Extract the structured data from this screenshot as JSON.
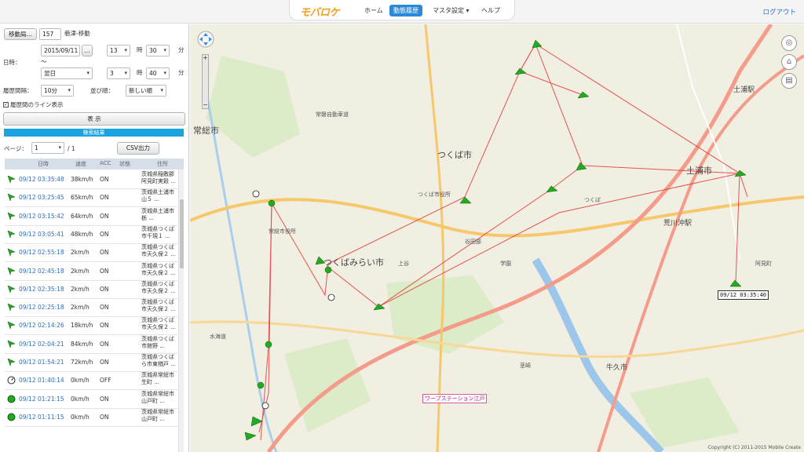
{
  "header": {
    "logo": "モバロケ",
    "nav": [
      "ホーム",
      "動態履歴",
      "マスタ設定 ▾",
      "ヘルプ"
    ],
    "active_index": 1,
    "logout": "ログアウト"
  },
  "search": {
    "device_button": "移動局...",
    "device_id": "157",
    "device_name": "砦津-移動",
    "datetime_label": "日時：",
    "start_date": "2015/09/11",
    "start_hour": "13",
    "hour_unit": "時",
    "start_min": "30",
    "min_unit": "分",
    "tilde": "～",
    "end_date": "翌日",
    "end_hour": "3",
    "end_min": "40",
    "interval_label": "履歴間隔：",
    "interval": "10分",
    "order_label": "並び順：",
    "order": "新しい順",
    "line_label": "履歴間のライン表示",
    "show_button": "表 示",
    "result_label": "検索結果",
    "page_label": "ページ：",
    "page": "1",
    "page_total": "/ 1",
    "csv_button": "CSV出力"
  },
  "table": {
    "headers": [
      "日時",
      "速度",
      "ACC",
      "状態",
      "住所"
    ],
    "rows": [
      {
        "dt": "09/12 03:35:48",
        "sp": "38km/h",
        "acc": "ON",
        "addr": "茨城県稲敷郡阿見町実穀 ...",
        "icon": "arrow-icon"
      },
      {
        "dt": "09/12 03:25:45",
        "sp": "65km/h",
        "acc": "ON",
        "addr": "茨城県土浦市山５ ...",
        "icon": "arrow-icon"
      },
      {
        "dt": "09/12 03:15:42",
        "sp": "64km/h",
        "acc": "ON",
        "addr": "茨城県土浦市栃 ...",
        "icon": "arrow-icon"
      },
      {
        "dt": "09/12 03:05:41",
        "sp": "48km/h",
        "acc": "ON",
        "addr": "茨城県つくば市千現１ ...",
        "icon": "arrow-icon"
      },
      {
        "dt": "09/12 02:55:18",
        "sp": "2km/h",
        "acc": "ON",
        "addr": "茨城県つくば市天久保２ ...",
        "icon": "arrow-icon"
      },
      {
        "dt": "09/12 02:45:18",
        "sp": "2km/h",
        "acc": "ON",
        "addr": "茨城県つくば市天久保２ ...",
        "icon": "arrow-icon"
      },
      {
        "dt": "09/12 02:35:18",
        "sp": "2km/h",
        "acc": "ON",
        "addr": "茨城県つくば市天久保２ ...",
        "icon": "arrow-icon"
      },
      {
        "dt": "09/12 02:25:18",
        "sp": "2km/h",
        "acc": "ON",
        "addr": "茨城県つくば市天久保２ ...",
        "icon": "arrow-icon"
      },
      {
        "dt": "09/12 02:14:26",
        "sp": "18km/h",
        "acc": "ON",
        "addr": "茨城県つくば市天久保２ ...",
        "icon": "arrow-icon"
      },
      {
        "dt": "09/12 02:04:21",
        "sp": "84km/h",
        "acc": "ON",
        "addr": "茨城県つくば市館野 ...",
        "icon": "arrow-icon"
      },
      {
        "dt": "09/12 01:54:21",
        "sp": "72km/h",
        "acc": "ON",
        "addr": "茨城県つくばら市東楢戸 ...",
        "icon": "arrow-icon"
      },
      {
        "dt": "09/12 01:40:14",
        "sp": "0km/h",
        "acc": "OFF",
        "addr": "茨城県常総市生町 ...",
        "icon": "stop-icon"
      },
      {
        "dt": "09/12 01:21:15",
        "sp": "0km/h",
        "acc": "ON",
        "addr": "茨城県常総市山戸町 ...",
        "icon": "idle-icon"
      },
      {
        "dt": "09/12 01:11:15",
        "sp": "0km/h",
        "acc": "ON",
        "addr": "茨城県常総市山戸町 ...",
        "icon": "idle-icon"
      }
    ]
  },
  "map": {
    "tooltip": "09/12 03:35:40",
    "copyright": "Copyright (C) 2011-2015 Mobile Create",
    "labels": {
      "tsukuba": "つくば市",
      "tsukubamirai": "つくばみらい市",
      "tsuchiura": "土浦市",
      "joso": "常総市",
      "arakawaoki": "荒川沖駅",
      "tsuchiura_station": "土浦駅",
      "kenkyu": "つくば市役所",
      "mirai_office": "常総市役所",
      "tsukuba_station": "つくば",
      "ami": "阿見町",
      "hitachi": "常磐自動車道",
      "gakuen": "学園",
      "kamiya": "上谷",
      "yatabe": "谷田部",
      "kukizaki": "茎崎",
      "ushiku": "牛久市",
      "wonderland": "ワープステーション江戸",
      "mitsukaido": "水海道"
    }
  },
  "colors": {
    "accent": "#2a8ad8",
    "result_bar": "#1aa3e0",
    "route": "#e03a3a",
    "marker": "#22aa22",
    "link": "#2a6fc0"
  }
}
